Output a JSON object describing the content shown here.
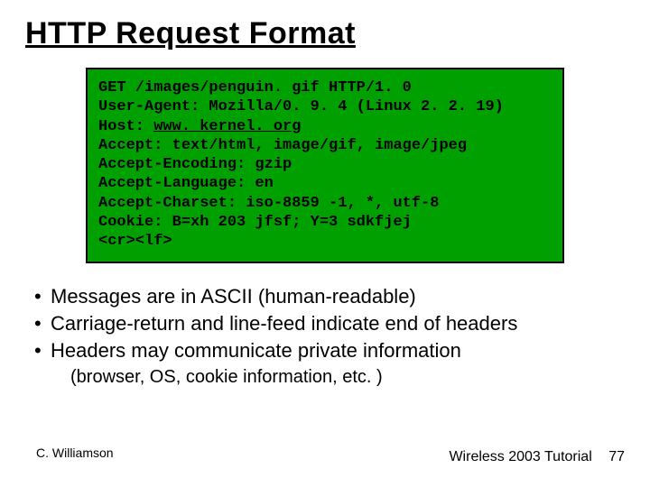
{
  "title": "HTTP Request Format",
  "code": {
    "line1": "GET /images/penguin. gif HTTP/1. 0",
    "line2": "User-Agent: Mozilla/0. 9. 4 (Linux 2. 2. 19)",
    "line3_prefix": "Host: ",
    "line3_link": "www. kernel. org",
    "line4": "Accept: text/html, image/gif, image/jpeg",
    "line5": "Accept-Encoding: gzip",
    "line6": "Accept-Language: en",
    "line7": "Accept-Charset: iso-8859 -1, *, utf-8",
    "line8": "Cookie: B=xh 203 jfsf; Y=3 sdkfjej",
    "line9": "<cr><lf>"
  },
  "bullets": {
    "b1": "Messages are in ASCII (human-readable)",
    "b2": "Carriage-return and line-feed indicate end of headers",
    "b3": "Headers may communicate private information",
    "sub": "(browser, OS, cookie information, etc. )"
  },
  "footer": {
    "author": "C. Williamson",
    "venue": "Wireless 2003 Tutorial",
    "page": "77"
  },
  "glyphs": {
    "bullet": "•"
  }
}
